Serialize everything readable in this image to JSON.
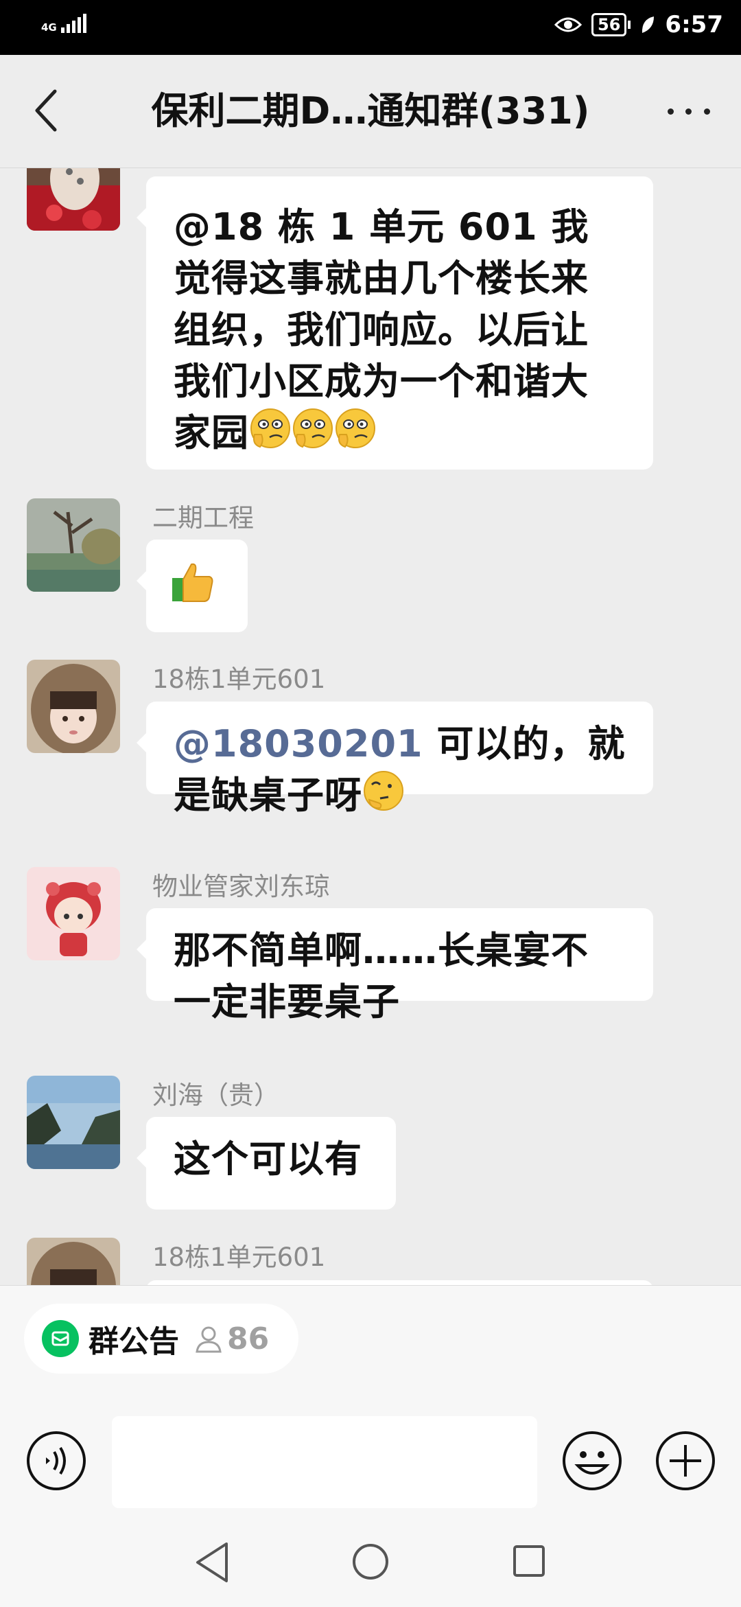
{
  "status_bar": {
    "network_text": "4G",
    "battery_level": "56",
    "time": "6:57"
  },
  "header": {
    "title": "保利二期D…通知群(331)"
  },
  "messages": [
    {
      "sender": "",
      "mention": "@18 栋 1 单元 601",
      "text": " 我觉得这事就由几个楼长来组织，我们响应。以后让我们小区成为一个和谐大家园",
      "emojis": [
        "smirk-emoji",
        "smirk-emoji",
        "smirk-emoji"
      ]
    },
    {
      "sender": "二期工程",
      "text": "",
      "emojis": [
        "thumbs-up-emoji"
      ]
    },
    {
      "sender": "18栋1单元601",
      "mention": "@18030201",
      "text": " 可以的，就是缺桌子呀",
      "emojis": [
        "thinking-emoji"
      ]
    },
    {
      "sender": "物业管家刘东琼",
      "text": "那不简单啊……长桌宴不一定非要桌子"
    },
    {
      "sender": "刘海（贵）",
      "text": "这个可以有"
    },
    {
      "sender": "18栋1单元601",
      "text": ""
    }
  ],
  "bottom": {
    "notice_label": "群公告",
    "member_count": "86",
    "input_value": "",
    "input_placeholder": ""
  },
  "colors": {
    "accent_green": "#07c160",
    "mention_blue": "#576b95",
    "background": "#ededed"
  }
}
